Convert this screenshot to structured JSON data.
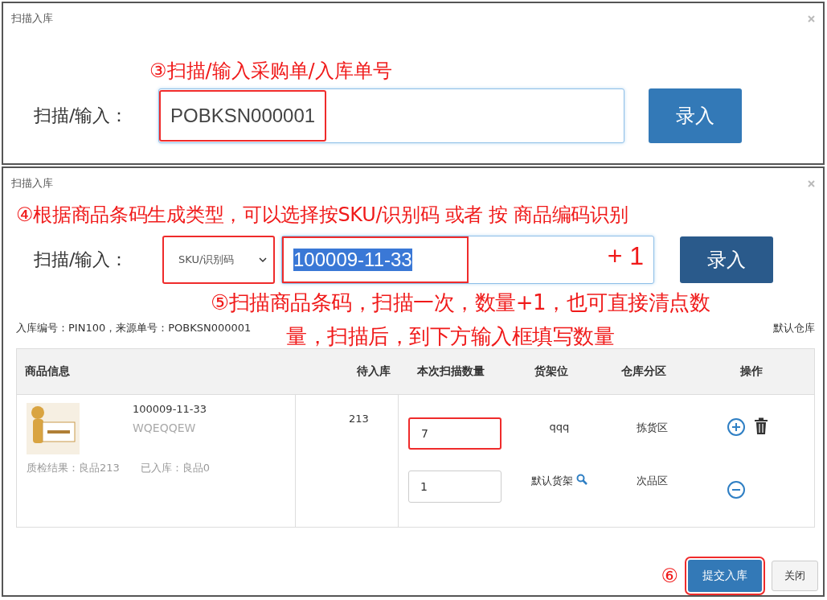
{
  "dialog_top": {
    "title": "扫描入库",
    "annotation": "③扫描/输入采购单/入库单号",
    "label": "扫描/输入：",
    "input": {
      "value": "POBKSN000001",
      "highlighted": true
    },
    "button": "录入"
  },
  "dialog_bottom": {
    "title": "扫描入库",
    "annotation_type": "④根据商品条码生成类型，可以选择按SKU/识别码 或者 按 商品编码识别",
    "label": "扫描/输入：",
    "select": {
      "value": "SKU/识别码",
      "highlighted": true
    },
    "input": {
      "value": "100009-11-33",
      "selected": true,
      "highlighted": true
    },
    "plus_note": "+ 1",
    "button": "录入",
    "annotation_scan": [
      "⑤扫描商品条码，扫描一次，数量+1，也可直接清点数",
      "量，扫描后，到下方输入框填写数量"
    ],
    "info": "入库编号：PIN100，来源单号：POBKSN000001",
    "warehouse": "默认仓库",
    "table": {
      "columns": [
        "商品信息",
        "待入库",
        "本次扫描数量",
        "货架位",
        "仓库分区",
        "操作"
      ],
      "product": {
        "code": "100009-11-33",
        "name": "WQEQQEW",
        "quality": "质检结果：良品213",
        "stocked": "已入库：良品0"
      },
      "pending": "213",
      "rows": [
        {
          "quantity": "7",
          "highlighted": true,
          "shelf": "qqq",
          "search": false,
          "zone": "拣货区",
          "actions": [
            {
              "kind": "add"
            },
            {
              "kind": "delete"
            }
          ]
        },
        {
          "quantity": "1",
          "highlighted": false,
          "shelf": "默认货架",
          "search": true,
          "zone": "次品区",
          "actions": [
            {
              "kind": "remove"
            }
          ]
        }
      ]
    },
    "step_mark": "⑥",
    "submit": {
      "label": "提交入库",
      "highlighted": true
    },
    "close": "关闭"
  }
}
